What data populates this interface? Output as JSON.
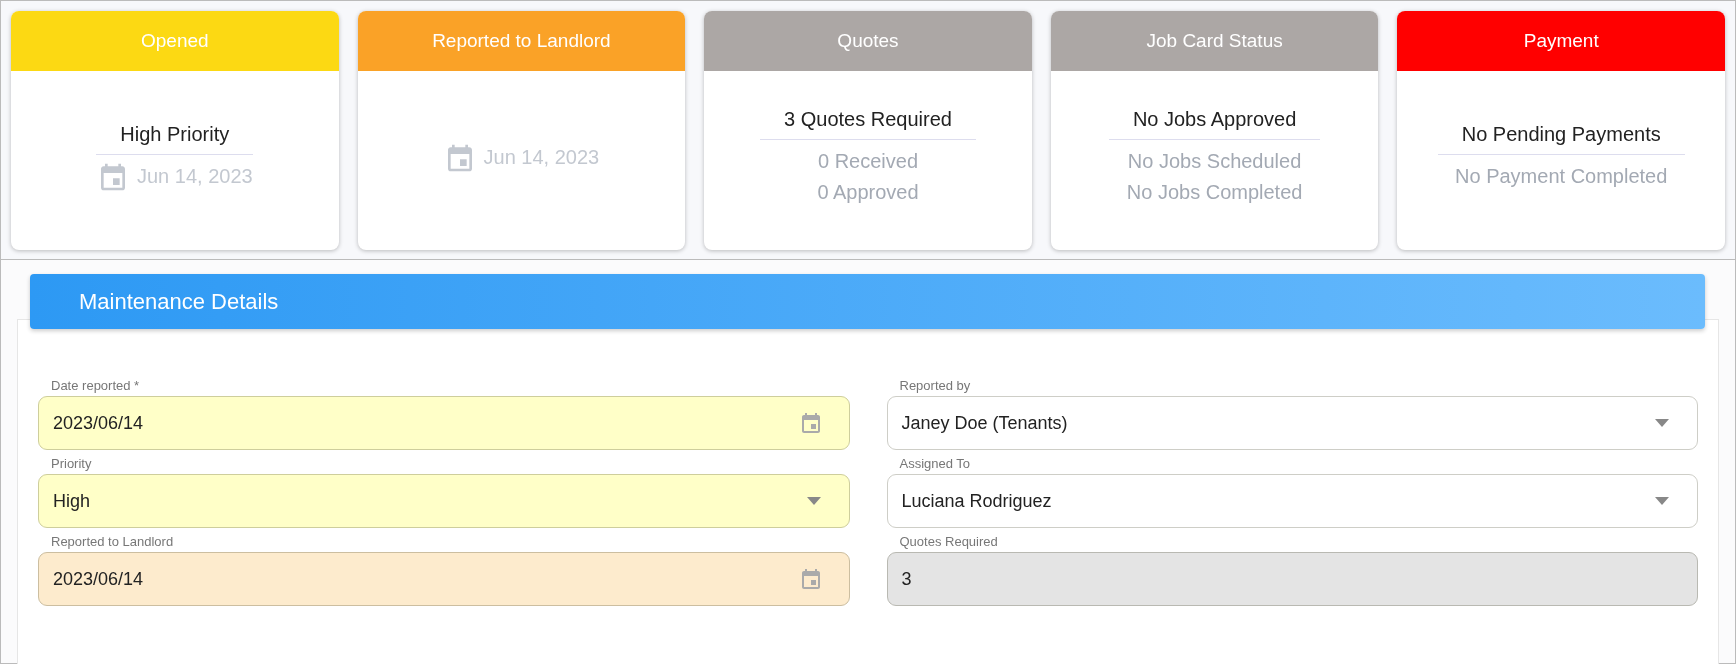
{
  "status_cards": [
    {
      "title": "Opened",
      "color": "#fcd913",
      "main": "High Priority",
      "date": "Jun 14, 2023"
    },
    {
      "title": "Reported to Landlord",
      "color": "#faa227",
      "date": "Jun 14, 2023"
    },
    {
      "title": "Quotes",
      "color": "#aca7a5",
      "main": "3 Quotes Required",
      "lines": [
        "0 Received",
        "0 Approved"
      ]
    },
    {
      "title": "Job Card Status",
      "color": "#aca7a5",
      "main": "No Jobs Approved",
      "lines": [
        "No Jobs Scheduled",
        "No Jobs Completed"
      ]
    },
    {
      "title": "Payment",
      "color": "#ff0000",
      "main": "No Pending Payments",
      "lines": [
        "No Payment Completed"
      ]
    }
  ],
  "maintenance_details": {
    "title": "Maintenance Details",
    "fields": [
      {
        "label": "Date reported *",
        "value": "2023/06/14",
        "kind": "date",
        "color": "#ffffc8"
      },
      {
        "label": "Reported by",
        "value": "Janey Doe (Tenants)",
        "kind": "select",
        "color": "#ffffff"
      },
      {
        "label": "Priority",
        "value": "High",
        "kind": "select",
        "color": "#ffffc8"
      },
      {
        "label": "Assigned To",
        "value": "Luciana Rodriguez",
        "kind": "select",
        "color": "#ffffff"
      },
      {
        "label": "Reported to Landlord",
        "value": "2023/06/14",
        "kind": "date",
        "color": "#fdebcd"
      },
      {
        "label": "Quotes Required",
        "value": "3",
        "kind": "text",
        "color": "#e4e4e4"
      }
    ]
  }
}
